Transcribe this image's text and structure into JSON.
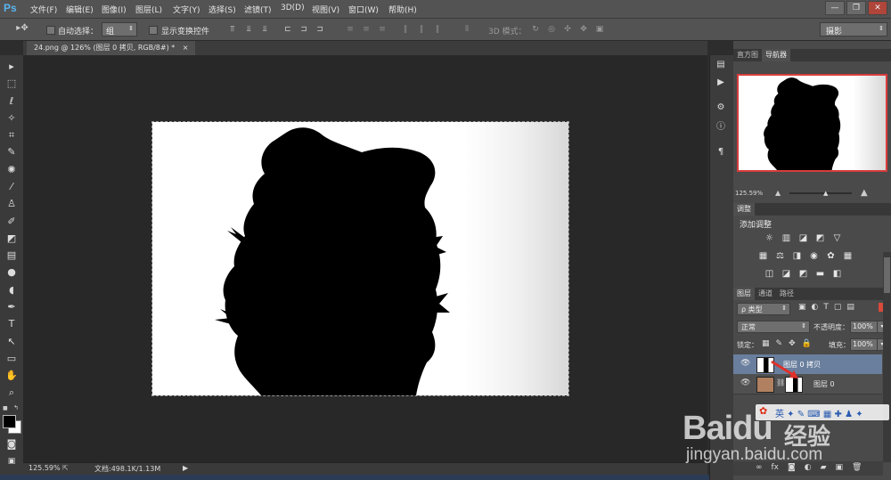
{
  "app": {
    "logo": "Ps",
    "menus": [
      "文件(F)",
      "编辑(E)",
      "图像(I)",
      "图层(L)",
      "文字(Y)",
      "选择(S)",
      "滤镜(T)",
      "3D(D)",
      "视图(V)",
      "窗口(W)",
      "帮助(H)"
    ],
    "window_controls": [
      "—",
      "❐",
      "✕"
    ]
  },
  "options": {
    "auto_select_label": "自动选择：",
    "auto_select_value": "组",
    "show_transform_label": "显示变换控件",
    "mode3d_label": "3D 模式：",
    "workspace_value": "摄影"
  },
  "document": {
    "tab_title": "24.png @ 126% (图层 0 拷贝, RGB/8#) *",
    "close_glyph": "×"
  },
  "status": {
    "zoom": "125.59%",
    "doc_info": "文档:498.1K/1.13M"
  },
  "navigator": {
    "tab_histogram": "直方图",
    "tab_navigator": "导航器",
    "zoom": "125.59%"
  },
  "adjustments": {
    "tab": "调整",
    "title": "添加调整"
  },
  "layers": {
    "tab_layers": "图层",
    "tab_channels": "通道",
    "tab_paths": "路径",
    "filter_label": "ρ 类型",
    "blend_mode": "正常",
    "opacity_label": "不透明度：",
    "opacity_value": "100%",
    "lock_label": "锁定：",
    "fill_label": "填充：",
    "fill_value": "100%",
    "items": [
      {
        "name": "图层 0 拷贝",
        "selected": true
      },
      {
        "name": "图层 0",
        "selected": false
      }
    ],
    "footer_icons": [
      "link-icon",
      "fx-icon",
      "mask-icon",
      "adjustment-icon",
      "folder-icon",
      "new-layer-icon",
      "trash-icon"
    ]
  },
  "watermark": {
    "brand": "Baidu",
    "brand_cn": "经验",
    "url": "jingyan.baidu.com"
  },
  "colors": {
    "menubar": "#535353",
    "panel": "#4a4a4a",
    "selected_layer": "#6a7f9e",
    "nav_frame": "#d83c3c",
    "ps_blue": "#5ab4f0",
    "baidu_red": "#de2910"
  }
}
